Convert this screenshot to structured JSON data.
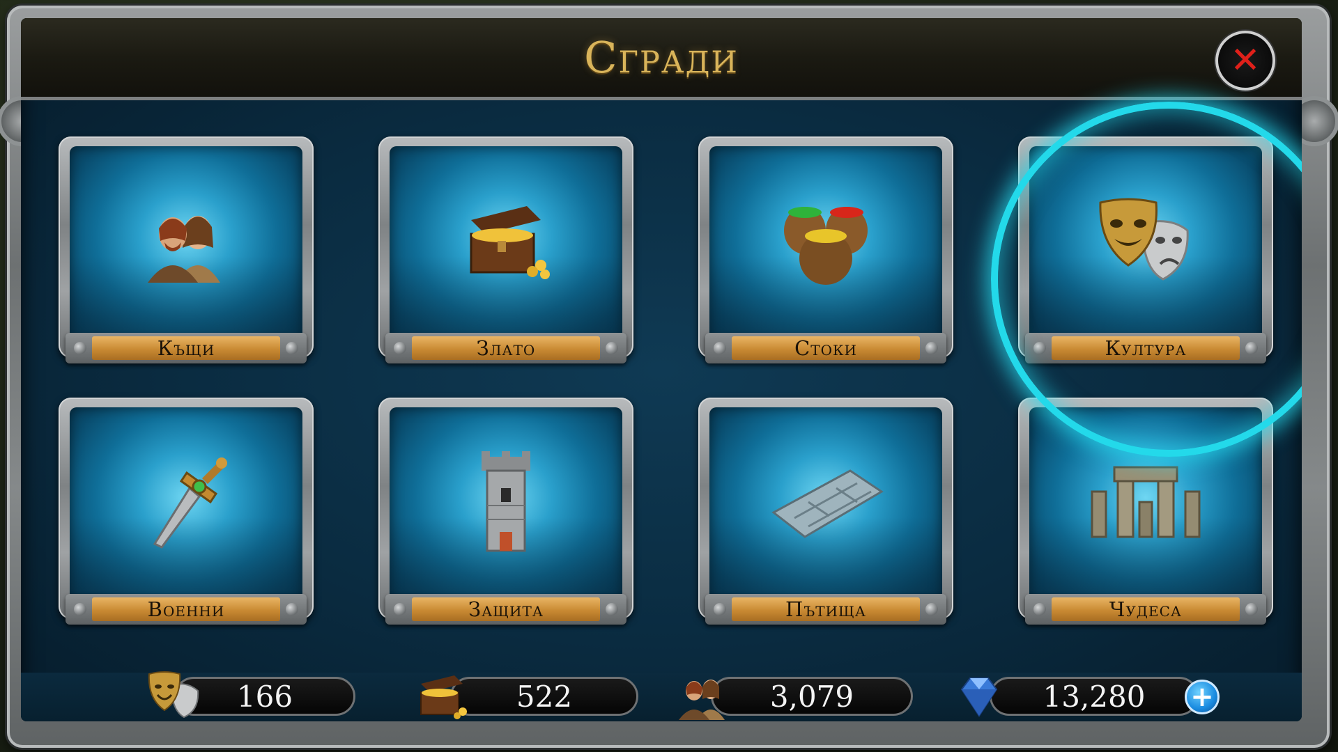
{
  "title": "Сгради",
  "close_icon": "✕",
  "tiles": [
    {
      "label": "Къщи",
      "icon": "people-icon"
    },
    {
      "label": "Злато",
      "icon": "treasure-chest-icon"
    },
    {
      "label": "Стоки",
      "icon": "goods-sacks-icon"
    },
    {
      "label": "Култура",
      "icon": "theater-masks-icon"
    },
    {
      "label": "Военни",
      "icon": "sword-icon"
    },
    {
      "label": "Защита",
      "icon": "tower-icon"
    },
    {
      "label": "Пътища",
      "icon": "road-icon"
    },
    {
      "label": "Чудеса",
      "icon": "stonehenge-icon"
    }
  ],
  "highlighted_tile": "Култура",
  "resources": {
    "culture": {
      "value": "166",
      "icon": "theater-masks-icon"
    },
    "gold": {
      "value": "522",
      "icon": "treasure-chest-icon"
    },
    "population": {
      "value": "3,079",
      "icon": "people-icon"
    },
    "gems": {
      "value": "13,280",
      "icon": "gem-icon",
      "plus": "+"
    }
  },
  "colors": {
    "title_gold": "#d9b45a",
    "highlight_cyan": "#23d9ea",
    "label_orange": "#c98a33",
    "close_red": "#e0201a"
  }
}
